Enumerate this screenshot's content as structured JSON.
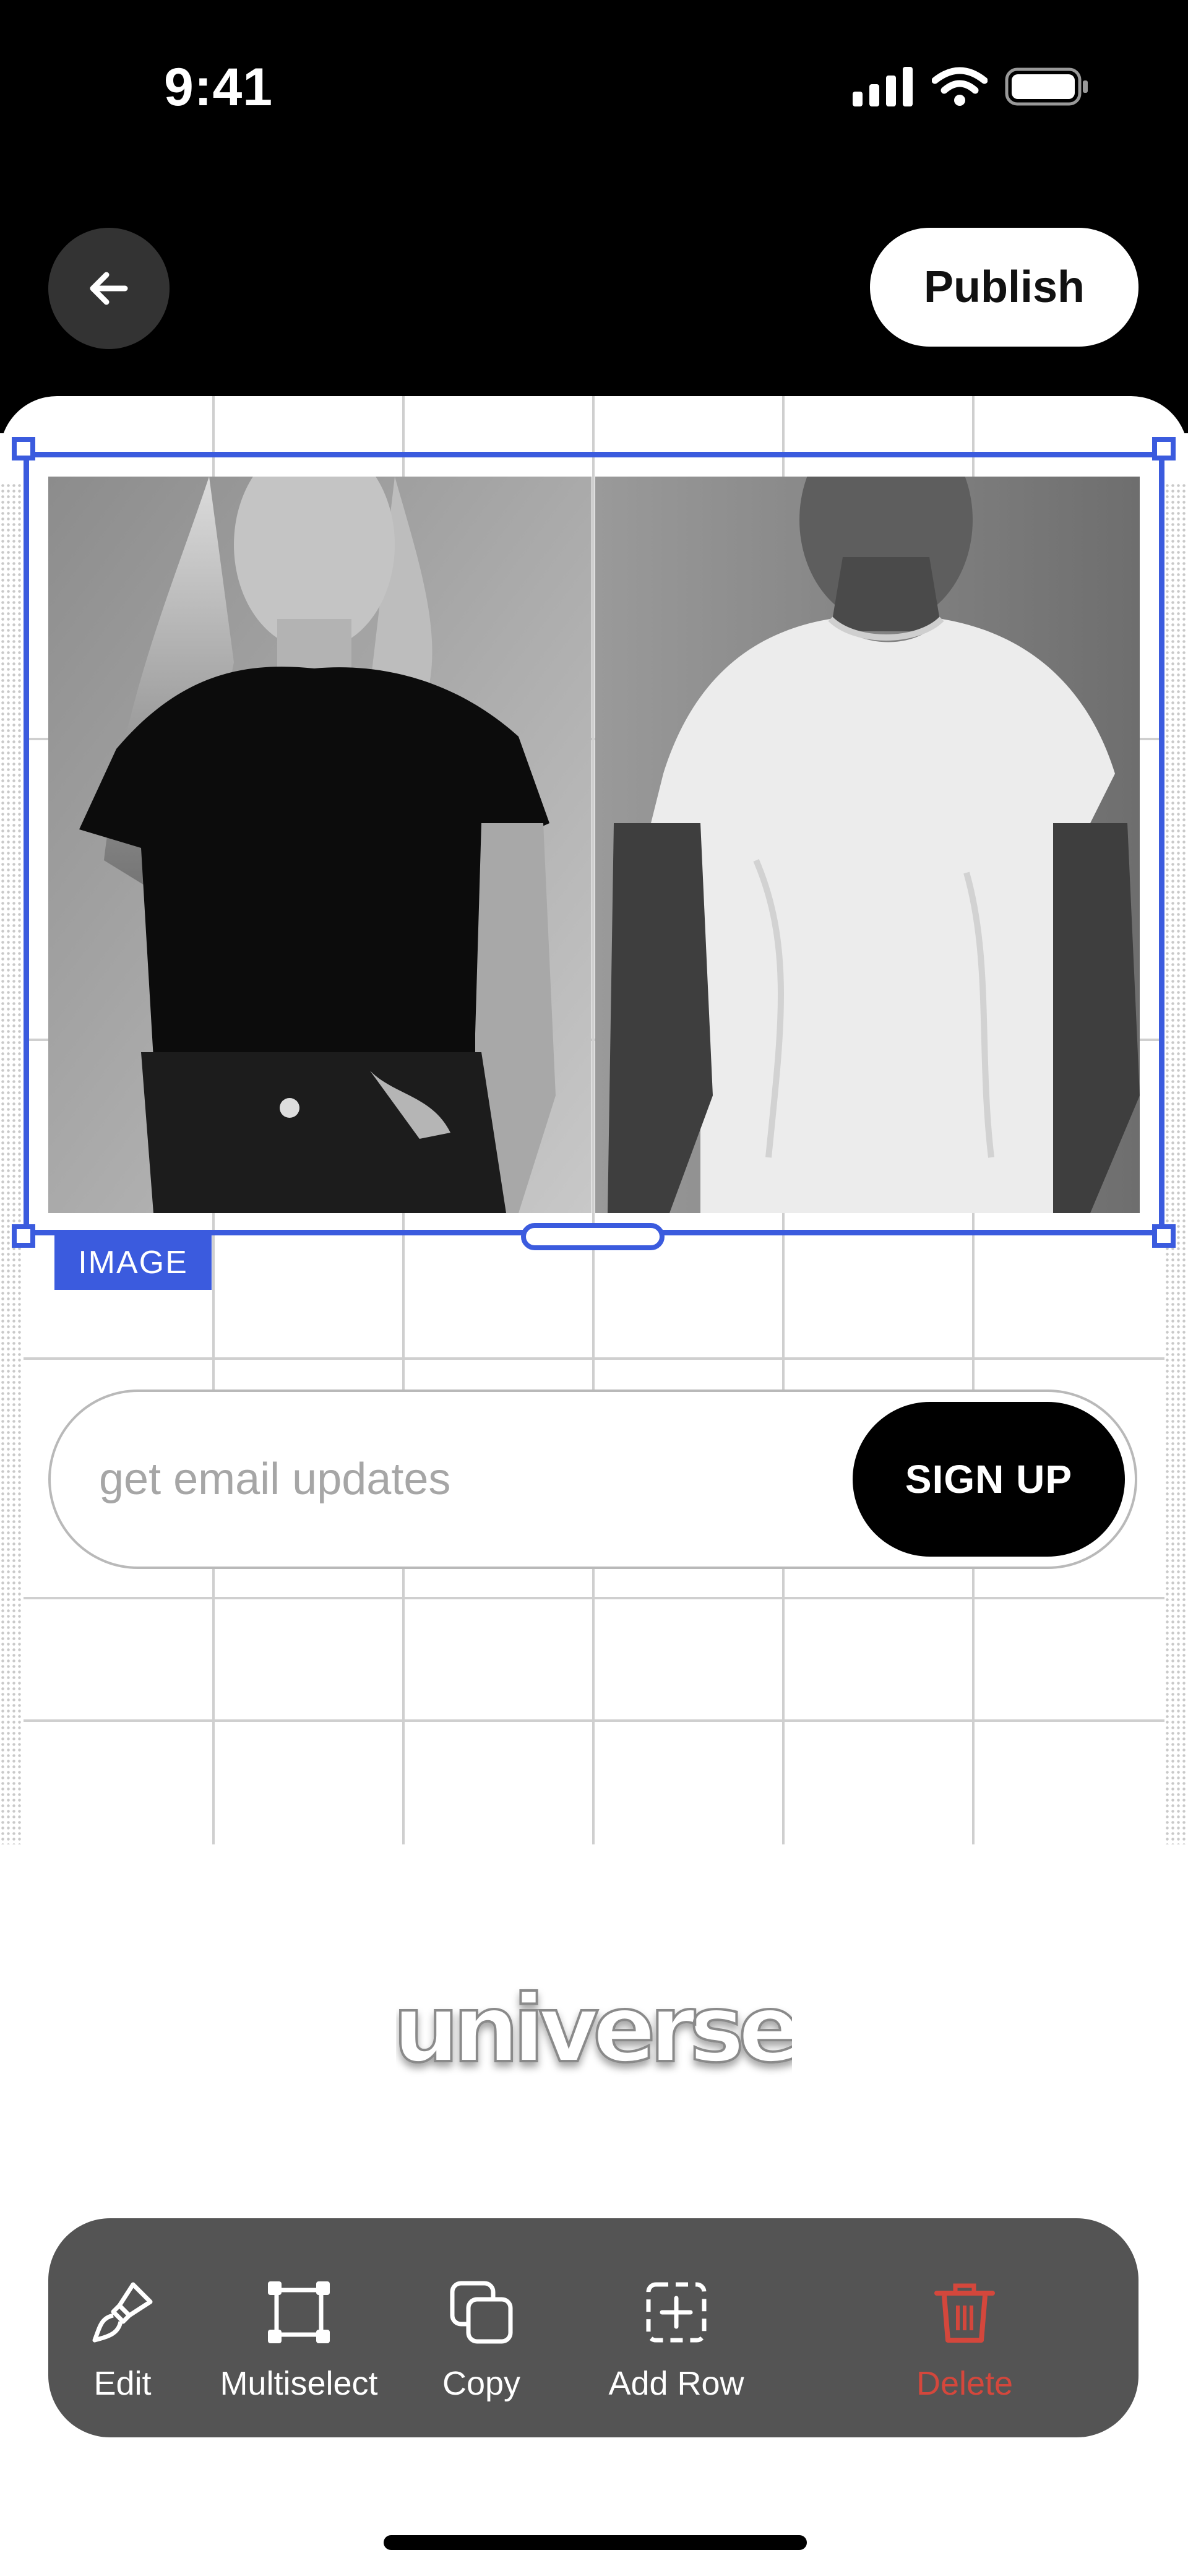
{
  "status_bar": {
    "time": "9:41"
  },
  "header": {
    "publish_label": "Publish"
  },
  "selection": {
    "tag_label": "IMAGE"
  },
  "email_form": {
    "placeholder": "get email updates",
    "signup_label": "SIGN UP"
  },
  "brand": {
    "logo_text": "universe"
  },
  "toolbar": {
    "items": [
      {
        "label": "Edit",
        "icon": "paintbrush-icon"
      },
      {
        "label": "Multiselect",
        "icon": "multiselect-icon"
      },
      {
        "label": "Copy",
        "icon": "copy-icon"
      },
      {
        "label": "Add Row",
        "icon": "add-row-icon"
      },
      {
        "label": "Delete",
        "icon": "trash-icon"
      }
    ]
  },
  "colors": {
    "selection_accent": "#3b5bde",
    "delete_red": "#d4473c",
    "toolbar_bg": "#545454",
    "header_bg": "#000000"
  }
}
